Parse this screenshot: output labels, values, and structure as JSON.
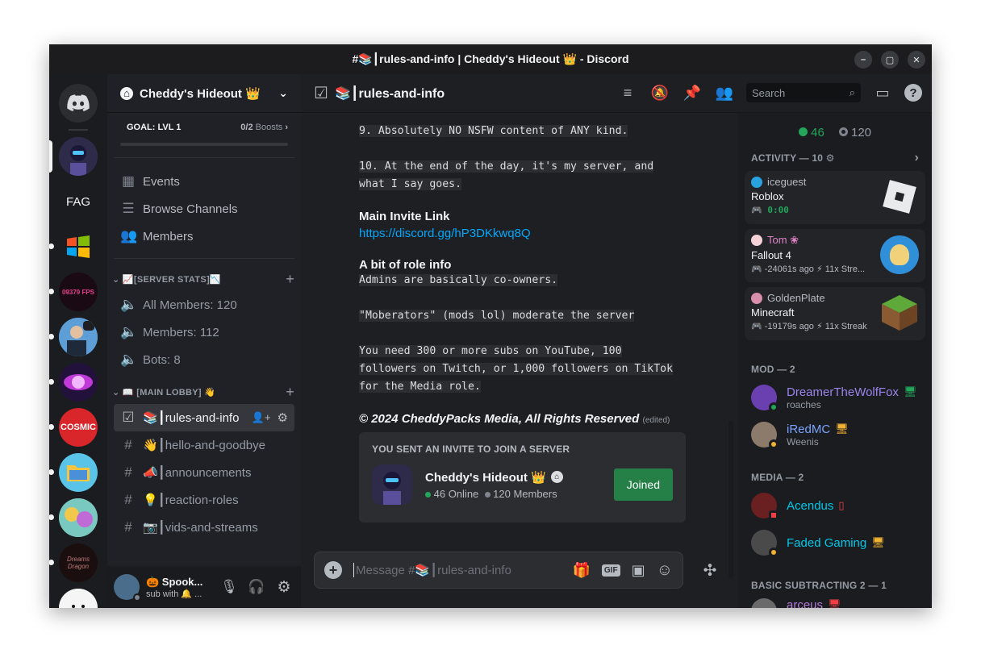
{
  "window": {
    "title": "#📚┃rules-and-info | Cheddy's Hideout 👑 - Discord"
  },
  "guilds": {
    "items": [
      {
        "name": "discord-home"
      },
      {
        "name": "server-1"
      },
      {
        "label": "FAG"
      },
      {
        "name": "server-windows"
      },
      {
        "label": "09379 FPS"
      },
      {
        "name": "server-suit"
      },
      {
        "name": "server-orb"
      },
      {
        "label": "COSMIC"
      },
      {
        "name": "server-folder"
      },
      {
        "name": "server-art"
      },
      {
        "label": "Dreams Dragon"
      },
      {
        "name": "server-ghost"
      }
    ]
  },
  "sidebar": {
    "server_name": "Cheddy's Hideout 👑",
    "goal_label": "GOAL: LVL 1",
    "goal_progress": "0/2",
    "goal_boosts": "Boosts",
    "nav": [
      {
        "label": "Events"
      },
      {
        "label": "Browse Channels"
      },
      {
        "label": "Members"
      }
    ],
    "categories": [
      {
        "label": "📈[SERVER STATS]📉",
        "channels": [
          {
            "label": "All Members: 120"
          },
          {
            "label": "Members: 112"
          },
          {
            "label": "Bots: 8"
          }
        ]
      },
      {
        "label": "📖 [MAIN LOBBY] 👋",
        "channels": [
          {
            "label": "📚┃rules-and-info"
          },
          {
            "label": "👋┃hello-and-goodbye"
          },
          {
            "label": "📣┃announcements"
          },
          {
            "label": "💡┃reaction-roles"
          },
          {
            "label": "📷┃vids-and-streams"
          }
        ]
      }
    ],
    "user": {
      "name": "🎃 Spook...",
      "status": "sub with 🔔 ..."
    }
  },
  "topbar": {
    "channel": "📚┃rules-and-info",
    "search_placeholder": "Search"
  },
  "messages": {
    "rule9": "9. Absolutely NO NSFW content of ANY kind.",
    "rule10_line1": "10. At the end of the day, it's my server, and",
    "rule10_line2": "what I say goes.",
    "invite_heading": "Main Invite Link",
    "invite_link": "https://discord.gg/hP3DKkwq8Q",
    "role_heading": "A bit of role info",
    "role1": "Admins are basically co-owners.",
    "role2": "\"Moberators\" (mods lol) moderate the server",
    "role3_line1": "You need 300 or more subs on YouTube, 100",
    "role3_line2": "followers on Twitch, or 1,000 followers on TikTok",
    "role3_line3": "for the Media role.",
    "copyright": "© 2024 CheddyPacks Media, All Rights Reserved",
    "edited": "(edited)",
    "invite_card": {
      "title": "YOU SENT AN INVITE TO JOIN A SERVER",
      "server": "Cheddy's Hideout 👑",
      "online": "46 Online",
      "members": "120 Members",
      "button": "Joined"
    }
  },
  "composer": {
    "placeholder": "Message #📚┃rules-and-info",
    "gif": "GIF"
  },
  "members": {
    "online": "46",
    "total": "120",
    "activity_label": "ACTIVITY — 10",
    "activities": [
      {
        "user": "iceguest",
        "game": "Roblox",
        "time": "0:00"
      },
      {
        "user": "Tom ❀",
        "game": "Fallout 4",
        "ago": "-24061s ago",
        "streak": "11x Stre..."
      },
      {
        "user": "GoldenPlate",
        "game": "Minecraft",
        "ago": "-19179s ago",
        "streak": "11x Streak"
      }
    ],
    "groups": [
      {
        "label": "MOD — 2",
        "members": [
          {
            "name": "DreamerTheWolfFox",
            "sub": "roaches",
            "color": "#9b84ec"
          },
          {
            "name": "iRedMC",
            "sub": "Weenis",
            "color": "#7aa3ff"
          }
        ]
      },
      {
        "label": "MEDIA — 2",
        "members": [
          {
            "name": "Acendus",
            "sub": "",
            "color": "#00c8e8"
          },
          {
            "name": "Faded Gaming",
            "sub": "",
            "color": "#00c8e8"
          }
        ]
      },
      {
        "label": "BASIC SUBTRACTING 2 — 1",
        "members": [
          {
            "name": "arceus",
            "sub": "",
            "color": "#b07ad8"
          }
        ]
      }
    ]
  },
  "colors": {
    "accent": "#5865f2",
    "online": "#23a55a",
    "join_button": "#248046",
    "link": "#00a8fc"
  }
}
